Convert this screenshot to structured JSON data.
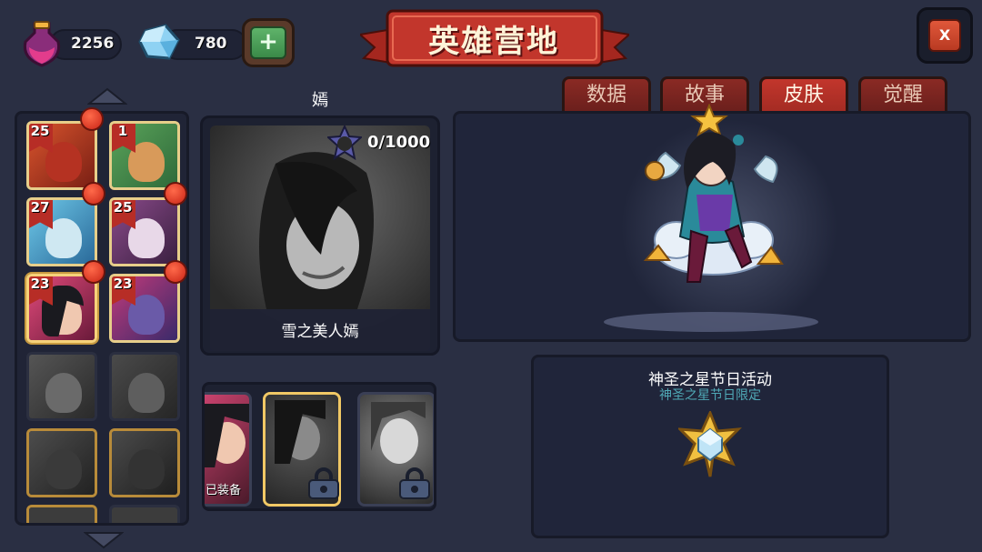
{
  "resources": {
    "potion_amount": "2256",
    "gem_amount": "780",
    "add_label": "+"
  },
  "header": {
    "title": "英雄营地",
    "close_label": "X"
  },
  "hero": {
    "name": "嫣",
    "skin_name": "雪之美人嫣",
    "shard_progress": "0/1000"
  },
  "tabs": [
    {
      "label": "数据",
      "active": false
    },
    {
      "label": "故事",
      "active": false
    },
    {
      "label": "皮肤",
      "active": true
    },
    {
      "label": "觉醒",
      "active": false
    }
  ],
  "hero_list": [
    {
      "level": "25",
      "owned": true
    },
    {
      "level": "1",
      "owned": true
    },
    {
      "level": "27",
      "owned": true
    },
    {
      "level": "25",
      "owned": true
    },
    {
      "level": "23",
      "owned": true,
      "selected": true
    },
    {
      "level": "23",
      "owned": true
    },
    {
      "level": "",
      "owned": false
    },
    {
      "level": "",
      "owned": false
    },
    {
      "level": "",
      "owned": false
    },
    {
      "level": "",
      "owned": false
    }
  ],
  "skins": {
    "equipped_label": "已装备"
  },
  "event": {
    "title": "神圣之星节日活动",
    "subtitle": "神圣之星节日限定"
  },
  "colors": {
    "background": "#2a2f43",
    "tab_active": "#c2362c",
    "tab_inactive": "#8a2a24",
    "accent_gold": "#f1c865",
    "event_subtitle": "#4fa9b6"
  }
}
